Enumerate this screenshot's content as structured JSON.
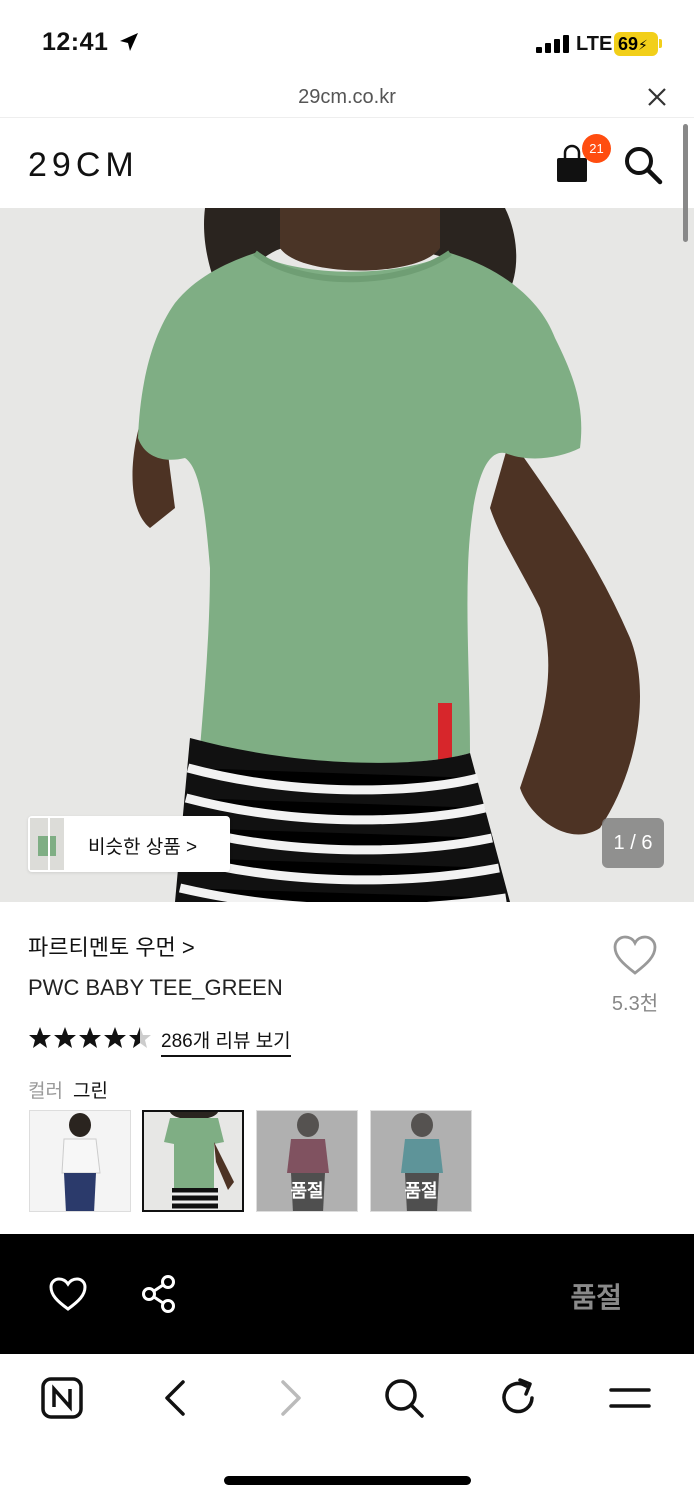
{
  "status": {
    "time": "12:41",
    "network": "LTE",
    "battery": "69"
  },
  "browser": {
    "url": "29cm.co.kr"
  },
  "header": {
    "logo": "29CM",
    "cart_count": "21"
  },
  "hero": {
    "similar_label": "비슷한 상품 >",
    "counter": "1 / 6"
  },
  "product": {
    "brand": "파르티멘토 우먼 >",
    "name": "PWC BABY TEE_GREEN",
    "wish_count": "5.3천",
    "rating_fraction": 0.9,
    "reviews_label": "286개 리뷰 보기",
    "color_key": "컬러",
    "color_value": "그린",
    "swatches": [
      {
        "color": "white",
        "selected": false,
        "soldout": ""
      },
      {
        "color": "green",
        "selected": true,
        "soldout": ""
      },
      {
        "color": "burgundy",
        "selected": false,
        "soldout": "품절"
      },
      {
        "color": "teal",
        "selected": false,
        "soldout": "품절"
      }
    ]
  },
  "action_bar": {
    "status_label": "품절"
  },
  "colors": {
    "accent_badge": "#ff4d10",
    "tee_green": "#7fae84",
    "battery": "#f2cf19"
  }
}
